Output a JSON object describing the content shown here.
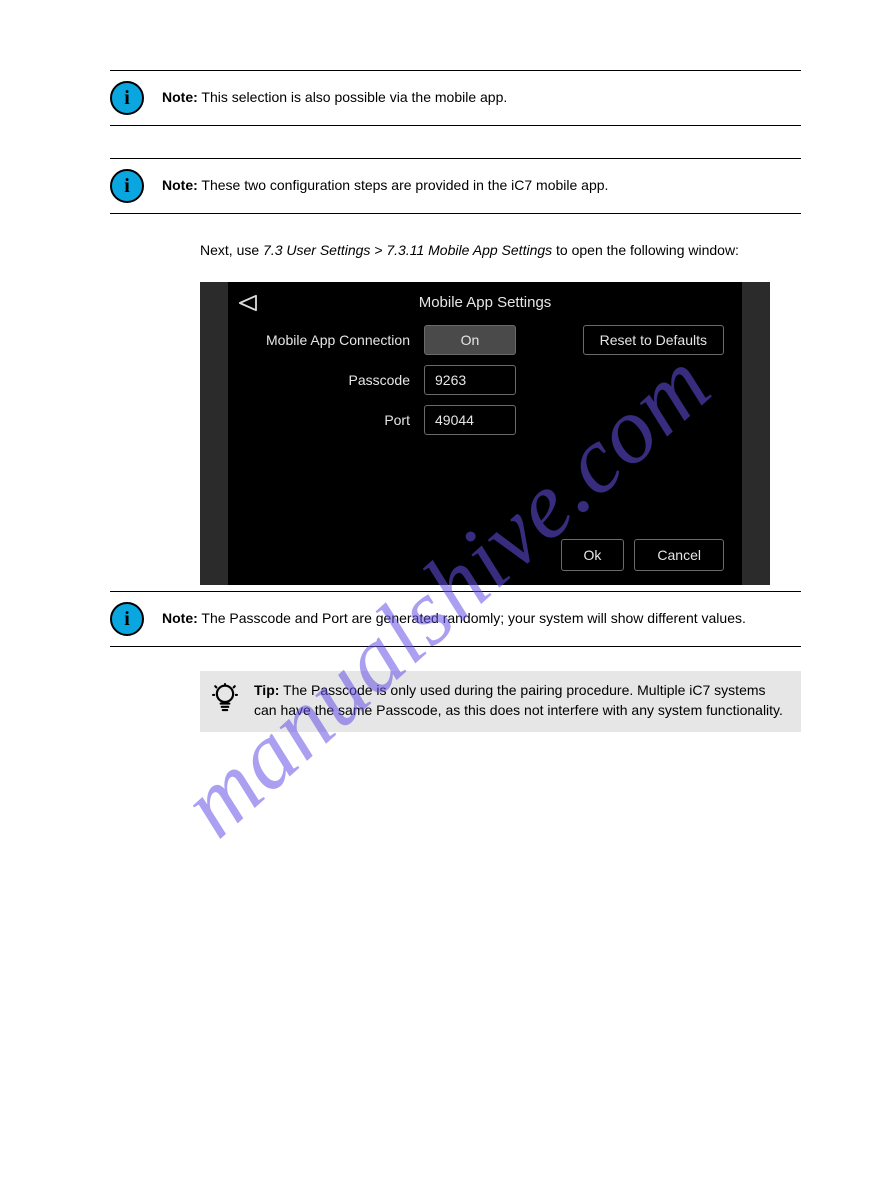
{
  "watermark": "manualshive.com",
  "note1": {
    "label": "Note:",
    "text": "This selection is also possible via the mobile app."
  },
  "note2": {
    "label": "Note:",
    "text": "These two configuration steps are provided in the iC7 mobile app."
  },
  "para1": {
    "prefix": "Next, use",
    "item": "7.3 User Settings > 7.3.11 Mobile App Settings",
    "suffix": "to open the following window:"
  },
  "screenshot": {
    "title": "Mobile App Settings",
    "rows": {
      "connection": {
        "label": "Mobile App Connection",
        "value": "On"
      },
      "passcode": {
        "label": "Passcode",
        "value": "9263"
      },
      "port": {
        "label": "Port",
        "value": "49044"
      }
    },
    "reset": "Reset to Defaults",
    "ok": "Ok",
    "cancel": "Cancel"
  },
  "note3": {
    "label": "Note:",
    "text": "The Passcode and Port are generated randomly; your system will show different values."
  },
  "tip": {
    "label": "Tip:",
    "text": "The Passcode is only used during the pairing procedure. Multiple iC7 systems can have the same Passcode, as this does not interfere with any system functionality."
  }
}
